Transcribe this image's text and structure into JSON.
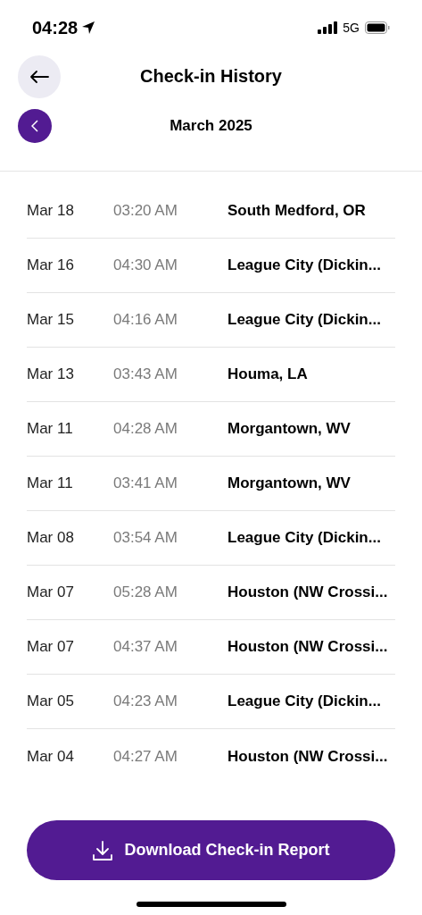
{
  "status_bar": {
    "time": "04:28",
    "network": "5G"
  },
  "header": {
    "title": "Check-in History"
  },
  "month": {
    "label": "March 2025"
  },
  "checkins": [
    {
      "date": "Mar 18",
      "time": "03:20 AM",
      "location": "South Medford, OR"
    },
    {
      "date": "Mar 16",
      "time": "04:30 AM",
      "location": "League City (Dickin..."
    },
    {
      "date": "Mar 15",
      "time": "04:16 AM",
      "location": "League City (Dickin..."
    },
    {
      "date": "Mar 13",
      "time": "03:43 AM",
      "location": "Houma, LA"
    },
    {
      "date": "Mar 11",
      "time": "04:28 AM",
      "location": "Morgantown, WV"
    },
    {
      "date": "Mar 11",
      "time": "03:41 AM",
      "location": "Morgantown, WV"
    },
    {
      "date": "Mar 08",
      "time": "03:54 AM",
      "location": "League City (Dickin..."
    },
    {
      "date": "Mar 07",
      "time": "05:28 AM",
      "location": "Houston (NW Crossi..."
    },
    {
      "date": "Mar 07",
      "time": "04:37 AM",
      "location": "Houston (NW Crossi..."
    },
    {
      "date": "Mar 05",
      "time": "04:23 AM",
      "location": "League City (Dickin..."
    },
    {
      "date": "Mar 04",
      "time": "04:27 AM",
      "location": "Houston (NW Crossi..."
    }
  ],
  "download_button": {
    "label": "Download Check-in Report"
  }
}
